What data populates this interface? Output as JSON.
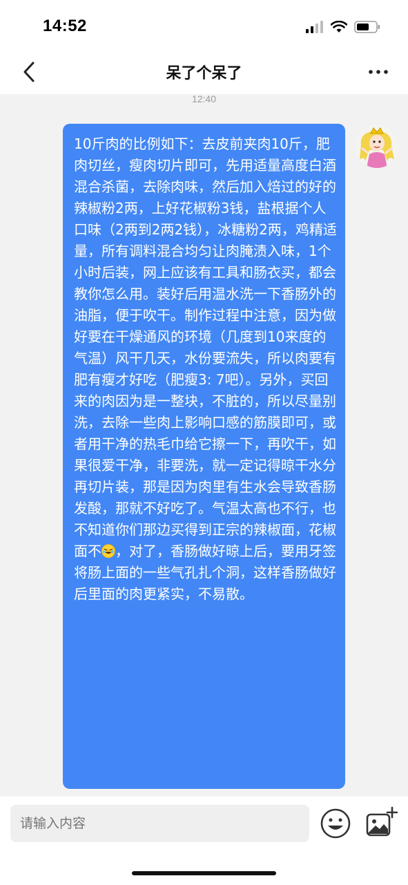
{
  "status_bar": {
    "time": "14:52"
  },
  "nav": {
    "title": "呆了个呆了"
  },
  "chat": {
    "timestamp": "12:40",
    "message_part1": "10斤肉的比例如下：去皮前夹肉10斤，肥肉切丝，瘦肉切片即可，先用适量高度白酒混合杀菌，去除肉味，然后加入焙过的好的辣椒粉2两，上好花椒粉3钱，盐根据个人口味（2两到2两2钱），冰糖粉2两，鸡精适量，所有调料混合均匀让肉腌渍入味，1个小时后装，网上应该有工具和肠衣买，都会教你怎么用。装好后用温水洗一下香肠外的油脂，便于吹干。制作过程中注意，因为做好要在干燥通风的环境（几度到10来度的气温）风干几天，水份要流失，所以肉要有肥有瘦才好吃（肥瘦3: 7吧）。另外，买回来的肉因为是一整块，不脏的，所以尽量别洗，去除一些肉上影响口感的筋膜即可，或者用干净的热毛巾给它擦一下，再吹干，如果很爱干净，非要洗，就一定记得晾干水分再切片装，那是因为肉里有生水会导致香肠发酸，那就不好吃了。气温太高也不行，也不知道你们那边买得到正宗的辣椒面，花椒面不",
    "message_part2": "，对了，香肠做好晾上后，要用牙签将肠上面的一些气孔扎个洞，这样香肠做好后里面的肉更紧实，不易散。"
  },
  "input": {
    "placeholder": "请输入内容"
  },
  "colors": {
    "bubble": "#4287f5",
    "background": "#f2f2f2"
  }
}
